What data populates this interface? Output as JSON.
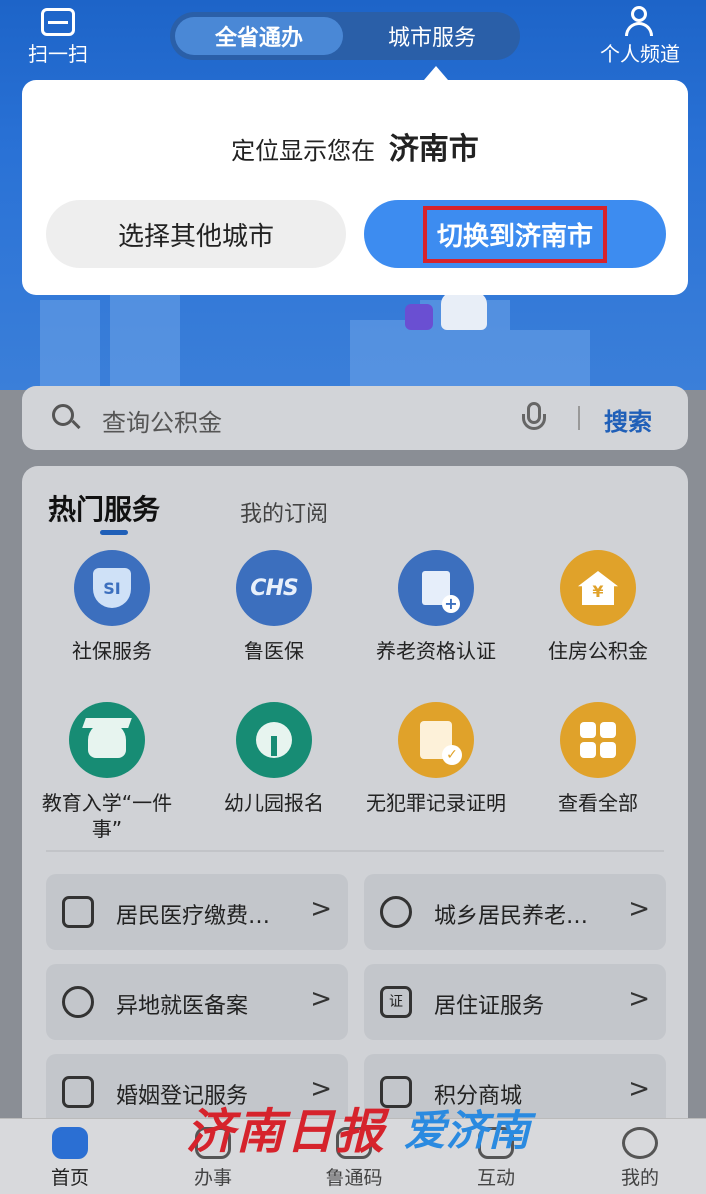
{
  "header": {
    "scan_label": "扫一扫",
    "tab_active": "全省通办",
    "tab_inactive": "城市服务",
    "personal_label": "个人频道"
  },
  "popup": {
    "message_prefix": "定位显示您在",
    "city": "济南市",
    "other_city_button": "选择其他城市",
    "switch_button": "切换到济南市"
  },
  "search": {
    "placeholder": "查询公积金",
    "button": "搜索"
  },
  "services": {
    "tab_hot": "热门服务",
    "tab_subscription": "我的订阅",
    "items": [
      {
        "label": "社保服务",
        "icon": "shield-icon",
        "color": "#3c6fbe"
      },
      {
        "label": "鲁医保",
        "icon": "chs-icon",
        "icon_text": "CHS",
        "color": "#3c6fbe"
      },
      {
        "label": "养老资格认证",
        "icon": "document-add-icon",
        "color": "#3c6fbe"
      },
      {
        "label": "住房公积金",
        "icon": "house-icon",
        "icon_text": "¥",
        "color": "#e0a22a"
      },
      {
        "label": "教育入学“一件事”",
        "icon": "graduation-icon",
        "color": "#178c74"
      },
      {
        "label": "幼儿园报名",
        "icon": "sprout-icon",
        "color": "#178c74"
      },
      {
        "label": "无犯罪记录证明",
        "icon": "certificate-icon",
        "color": "#e0a22a"
      },
      {
        "label": "查看全部",
        "icon": "grid-icon",
        "color": "#e0a22a"
      }
    ],
    "links": [
      {
        "label": "居民医疗缴费…",
        "icon": "medical-bag-icon"
      },
      {
        "label": "城乡居民养老…",
        "icon": "elderly-icon"
      },
      {
        "label": "异地就医备案",
        "icon": "location-plus-icon"
      },
      {
        "label": "居住证服务",
        "icon": "id-house-icon",
        "icon_text": "证"
      },
      {
        "label": "婚姻登记服务",
        "icon": "marriage-doc-icon"
      },
      {
        "label": "积分商城",
        "icon": "shopping-bag-icon"
      }
    ],
    "link_arrow": ">"
  },
  "tabbar": {
    "items": [
      {
        "label": "首页",
        "icon": "home-icon",
        "active": true
      },
      {
        "label": "办事",
        "icon": "briefcase-icon",
        "active": false
      },
      {
        "label": "鲁通码",
        "icon": "qr-icon",
        "active": false
      },
      {
        "label": "互动",
        "icon": "chat-icon",
        "active": false
      },
      {
        "label": "我的",
        "icon": "profile-icon",
        "active": false
      }
    ]
  },
  "watermark": {
    "text1": "济南日报",
    "text2": "爱济南"
  },
  "colors": {
    "primary_blue": "#3d8cf0",
    "highlight_red": "#d6232c"
  }
}
